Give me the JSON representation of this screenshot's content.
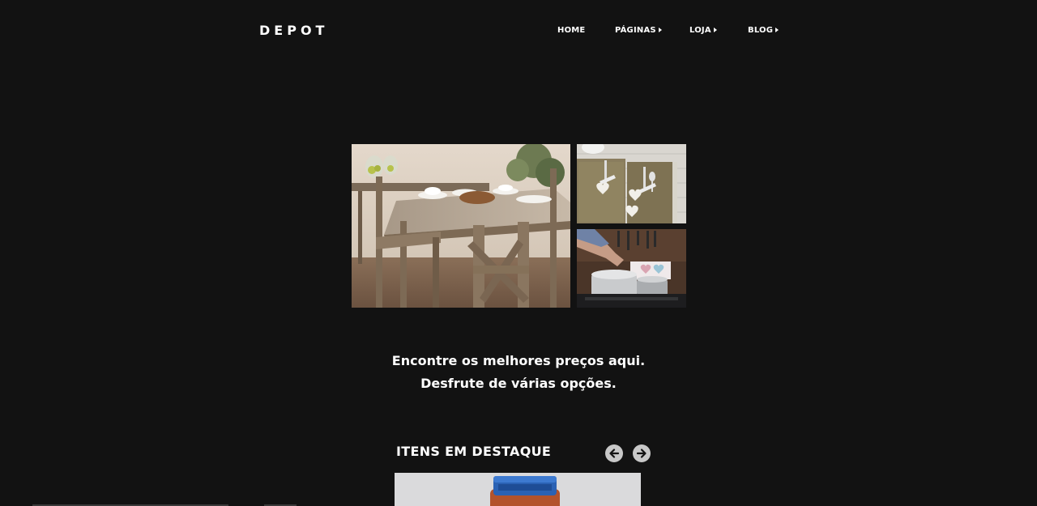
{
  "header": {
    "logo": "DEPOT",
    "nav": [
      {
        "label": "HOME",
        "has_caret": false
      },
      {
        "label": "PÁGINAS",
        "has_caret": true
      },
      {
        "label": "LOJA",
        "has_caret": true
      },
      {
        "label": "BLOG",
        "has_caret": true
      }
    ]
  },
  "hero": {
    "tagline_line1": "Encontre os melhores preços aqui.",
    "tagline_line2": "Desfrute de várias opções."
  },
  "featured": {
    "title": "ITENS EM DESTAQUE",
    "prev_icon": "arrow-left-icon",
    "next_icon": "arrow-right-icon"
  },
  "colors": {
    "background": "#121212",
    "text": "#ffffff",
    "arrow_button": "#c8c8c8"
  }
}
